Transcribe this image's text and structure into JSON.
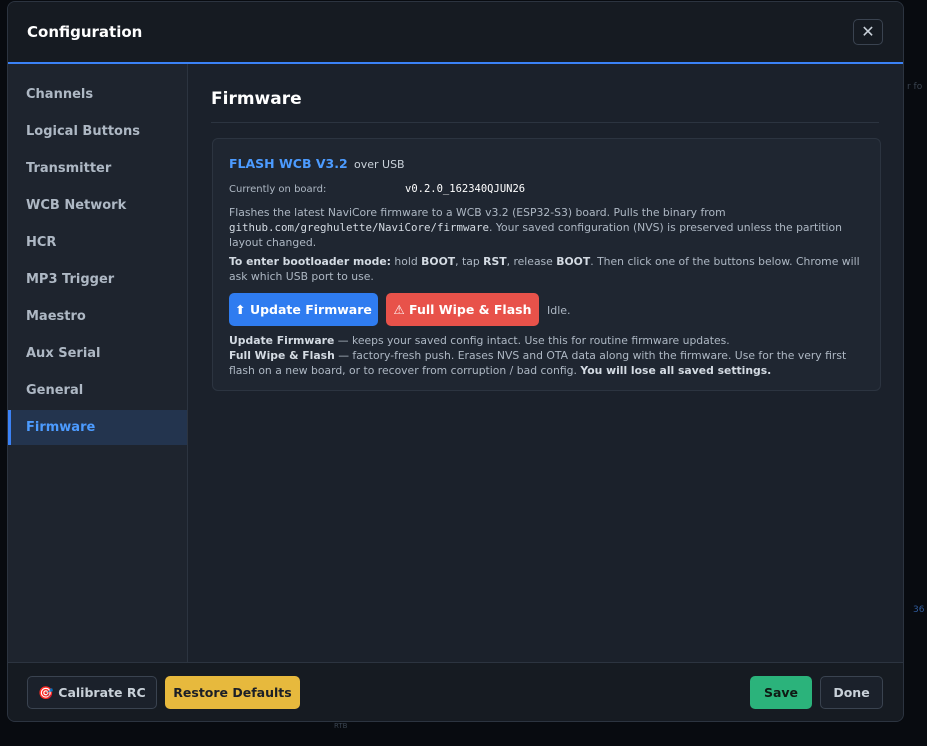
{
  "modal": {
    "title": "Configuration",
    "close_label": "✕"
  },
  "sidebar": {
    "items": [
      {
        "label": "Channels"
      },
      {
        "label": "Logical Buttons"
      },
      {
        "label": "Transmitter"
      },
      {
        "label": "WCB Network"
      },
      {
        "label": "HCR"
      },
      {
        "label": "MP3 Trigger"
      },
      {
        "label": "Maestro"
      },
      {
        "label": "Aux Serial"
      },
      {
        "label": "General"
      },
      {
        "label": "Firmware"
      }
    ],
    "active": "Firmware"
  },
  "firmware": {
    "section_title": "Firmware",
    "card_title": "FLASH WCB V3.2",
    "card_subtitle": "over USB",
    "current_label": "Currently on board:",
    "current_value": "v0.2.0_162340QJUN26",
    "desc_a": "Flashes the latest NaviCore firmware to a WCB v3.2 (ESP32-S3) board. Pulls the binary from ",
    "desc_path": "github.com/greghulette/NaviCore/firmware",
    "desc_b": ". Your saved configuration (NVS) is preserved unless the partition layout changed.",
    "boot_heading": "To enter bootloader mode:",
    "boot_1": " hold ",
    "boot_key_1": "BOOT",
    "boot_2": ", tap ",
    "boot_key_2": "RST",
    "boot_3": ", release ",
    "boot_key_3": "BOOT",
    "boot_4": ". Then click one of the buttons below. Chrome will ask which USB port to use.",
    "update_button": "⬆ Update Firmware",
    "wipe_button": "⚠ Full Wipe & Flash",
    "status": "Idle.",
    "note_update_name": "Update Firmware",
    "note_update_text": " — keeps your saved config intact. Use this for routine firmware updates.",
    "note_wipe_name": "Full Wipe & Flash",
    "note_wipe_text": " — factory-fresh push. Erases NVS and OTA data along with the firmware. Use for the very first flash on a new board, or to recover from corruption / bad config. ",
    "note_wipe_warning": "You will lose all saved settings."
  },
  "footer": {
    "calibrate_label": "🎯 Calibrate RC",
    "restore_label": "Restore Defaults",
    "save_label": "Save",
    "done_label": "Done"
  },
  "background": {
    "fragment_1": "r fo",
    "fragment_2": "36",
    "fragment_3": "RTB"
  },
  "colors": {
    "accent": "#3b82f6",
    "danger": "#e8524a",
    "warning": "#e7b93d",
    "success": "#2bb37b"
  }
}
